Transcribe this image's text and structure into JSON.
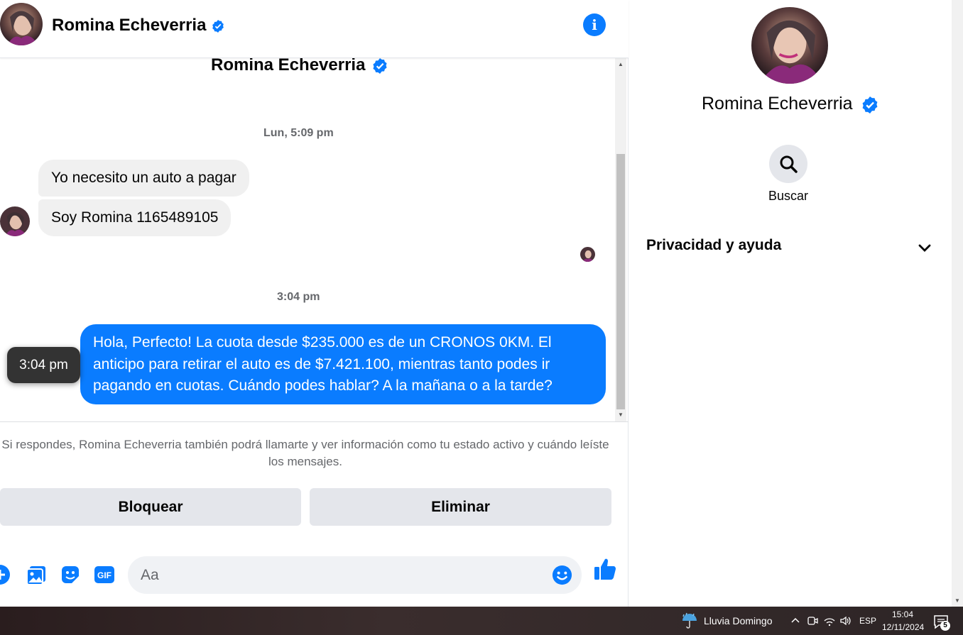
{
  "header": {
    "name": "Romina Echeverria"
  },
  "conversation": {
    "name": "Romina Echeverria",
    "timestamp_1": "Lun, 5:09 pm",
    "incoming": [
      "Yo necesito un auto a pagar",
      "Soy Romina 1165489105"
    ],
    "timestamp_2": "3:04 pm",
    "outgoing": "Hola, Perfecto! La cuota desde $235.000 es de un CRONOS 0KM. El anticipo para retirar el auto es de $7.421.100, mientras tanto podes ir pagando en cuotas. Cuándo podes hablar? A la mañana o a la tarde?",
    "tooltip": "3:04 pm"
  },
  "footer": {
    "notice": "Si respondes, Romina Echeverria también podrá llamarte y ver información como tu estado activo y cuándo leíste los mensajes.",
    "block_label": "Bloquear",
    "delete_label": "Eliminar",
    "input_placeholder": "Aa"
  },
  "sidebar": {
    "name": "Romina Echeverria",
    "search_label": "Buscar",
    "privacy_label": "Privacidad y ayuda"
  },
  "taskbar": {
    "weather": "Lluvia Domingo",
    "language": "ESP",
    "time": "15:04",
    "date": "12/11/2024",
    "notifications": "5"
  },
  "colors": {
    "accent": "#0a7cff",
    "bubble_in": "#f0f0f0",
    "button_bg": "#e4e6eb"
  }
}
